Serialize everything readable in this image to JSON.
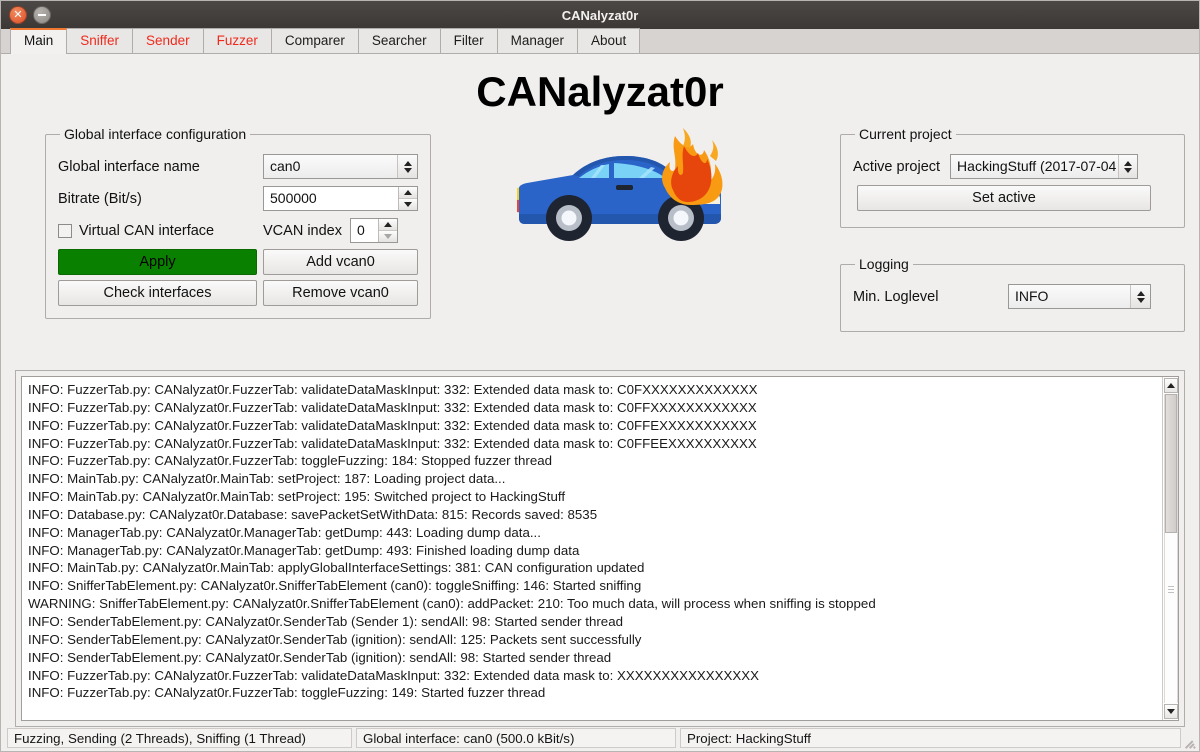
{
  "window": {
    "title": "CANalyzat0r",
    "close_icon": "close-icon",
    "minimize_icon": "minimize-icon"
  },
  "tabs": [
    {
      "label": "Main",
      "active": true,
      "red": false
    },
    {
      "label": "Sniffer",
      "active": false,
      "red": true
    },
    {
      "label": "Sender",
      "active": false,
      "red": true
    },
    {
      "label": "Fuzzer",
      "active": false,
      "red": true
    },
    {
      "label": "Comparer",
      "active": false,
      "red": false
    },
    {
      "label": "Searcher",
      "active": false,
      "red": false
    },
    {
      "label": "Filter",
      "active": false,
      "red": false
    },
    {
      "label": "Manager",
      "active": false,
      "red": false
    },
    {
      "label": "About",
      "active": false,
      "red": false
    }
  ],
  "app_title": "CANalyzat0r",
  "interface_group": {
    "legend": "Global interface configuration",
    "interface_name_label": "Global interface name",
    "interface_name_value": "can0",
    "bitrate_label": "Bitrate (Bit/s)",
    "bitrate_value": "500000",
    "virtual_can_label": "Virtual CAN interface",
    "virtual_can_checked": false,
    "vcan_index_label": "VCAN index",
    "vcan_index_value": "0",
    "apply_label": "Apply",
    "add_vcan_label": "Add vcan0",
    "check_interfaces_label": "Check interfaces",
    "remove_vcan_label": "Remove vcan0",
    "apply_color": "#0a8000"
  },
  "project_group": {
    "legend": "Current project",
    "active_project_label": "Active project",
    "active_project_value": "HackingStuff (2017-07-04",
    "set_active_label": "Set active"
  },
  "logging_group": {
    "legend": "Logging",
    "loglevel_label": "Min. Loglevel",
    "loglevel_value": "INFO"
  },
  "log": {
    "lines": [
      "INFO: FuzzerTab.py: CANalyzat0r.FuzzerTab: validateDataMaskInput: 332: Extended data mask to: C0FXXXXXXXXXXXXX",
      "INFO: FuzzerTab.py: CANalyzat0r.FuzzerTab: validateDataMaskInput: 332: Extended data mask to: C0FFXXXXXXXXXXXX",
      "INFO: FuzzerTab.py: CANalyzat0r.FuzzerTab: validateDataMaskInput: 332: Extended data mask to: C0FFEXXXXXXXXXXX",
      "INFO: FuzzerTab.py: CANalyzat0r.FuzzerTab: validateDataMaskInput: 332: Extended data mask to: C0FFEEXXXXXXXXXX",
      "INFO: FuzzerTab.py: CANalyzat0r.FuzzerTab: toggleFuzzing: 184: Stopped fuzzer thread",
      "INFO: MainTab.py: CANalyzat0r.MainTab: setProject: 187: Loading project data...",
      "INFO: MainTab.py: CANalyzat0r.MainTab: setProject: 195: Switched project to HackingStuff",
      "INFO: Database.py: CANalyzat0r.Database: savePacketSetWithData: 815: Records saved: 8535",
      "INFO: ManagerTab.py: CANalyzat0r.ManagerTab: getDump: 443: Loading dump data...",
      "INFO: ManagerTab.py: CANalyzat0r.ManagerTab: getDump: 493: Finished loading dump data",
      "INFO: MainTab.py: CANalyzat0r.MainTab: applyGlobalInterfaceSettings: 381: CAN configuration updated",
      "INFO: SnifferTabElement.py: CANalyzat0r.SnifferTabElement (can0): toggleSniffing: 146: Started sniffing",
      "WARNING: SnifferTabElement.py: CANalyzat0r.SnifferTabElement (can0): addPacket: 210: Too much data, will process when sniffing is stopped",
      "INFO: SenderTabElement.py: CANalyzat0r.SenderTab (Sender 1): sendAll: 98: Started sender thread",
      "INFO: SenderTabElement.py: CANalyzat0r.SenderTab (ignition): sendAll: 125: Packets sent successfully",
      "INFO: SenderTabElement.py: CANalyzat0r.SenderTab (ignition): sendAll: 98: Started sender thread",
      "INFO: FuzzerTab.py: CANalyzat0r.FuzzerTab: validateDataMaskInput: 332: Extended data mask to: XXXXXXXXXXXXXXXX",
      "INFO: FuzzerTab.py: CANalyzat0r.FuzzerTab: toggleFuzzing: 149: Started fuzzer thread"
    ],
    "scroll_up_icon": "caret-up-icon",
    "scroll_down_icon": "caret-down-icon"
  },
  "statusbar": {
    "threads": "Fuzzing, Sending (2 Threads), Sniffing (1 Thread)",
    "interface": "Global interface: can0 (500.0 kBit/s)",
    "project": "Project: HackingStuff"
  },
  "car_image": {
    "name": "burning-car-illustration",
    "body_color": "#2b64c8",
    "body_shadow": "#1f4fa8",
    "window_color": "#6fd0f5",
    "flame_outer": "#f59a15",
    "flame_inner": "#e8450a",
    "tail_light": "#f0d020",
    "tail_light_red": "#e8453c"
  }
}
